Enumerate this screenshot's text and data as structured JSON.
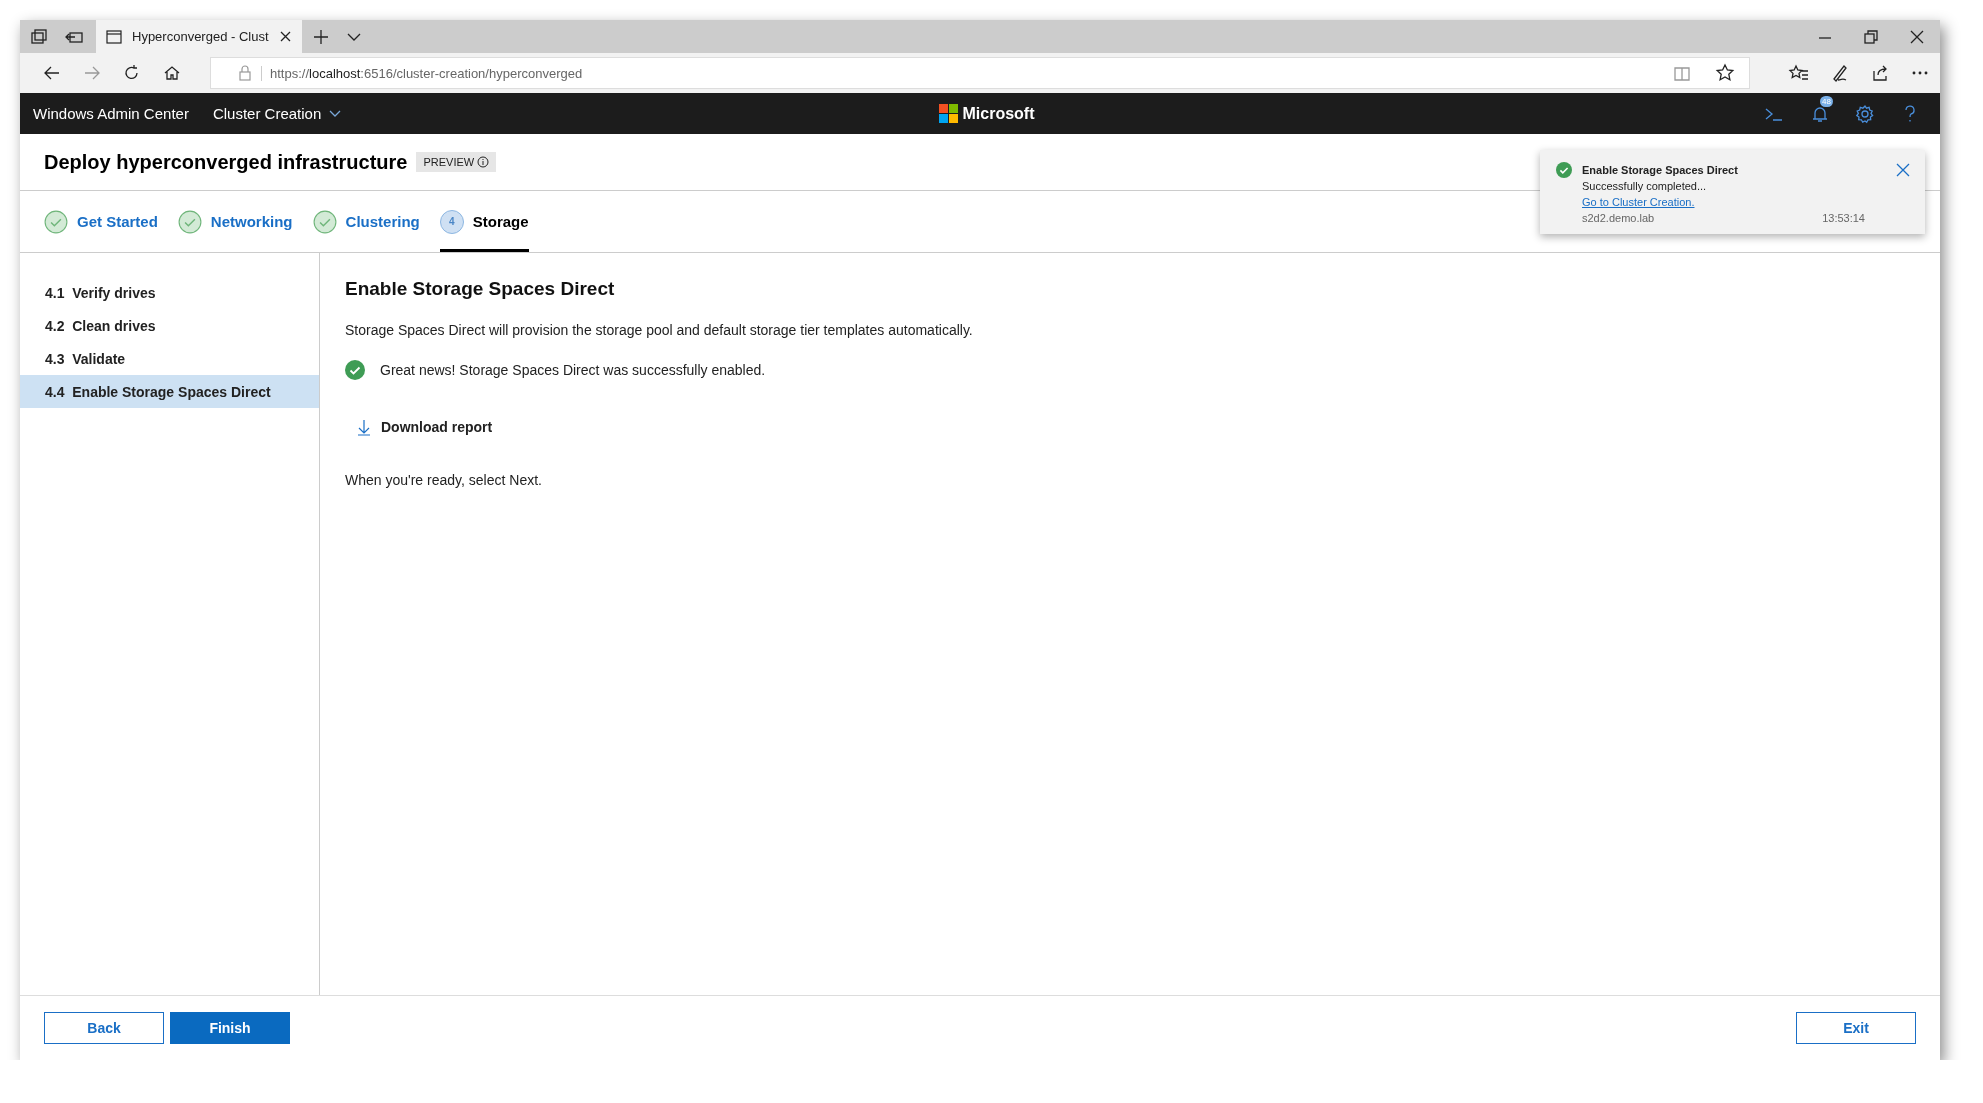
{
  "browser": {
    "tab_title": "Hyperconverged - Clust",
    "url_scheme": "https://",
    "url_host": "localhost",
    "url_rest": ":6516/cluster-creation/hyperconverged"
  },
  "app_bar": {
    "app_name": "Windows Admin Center",
    "context": "Cluster Creation",
    "brand": "Microsoft",
    "notification_count": "48"
  },
  "page": {
    "title": "Deploy hyperconverged infrastructure",
    "badge": "PREVIEW"
  },
  "steps": [
    {
      "label": "Get Started",
      "kind": "done",
      "selected": false
    },
    {
      "label": "Networking",
      "kind": "done",
      "selected": false
    },
    {
      "label": "Clustering",
      "kind": "done",
      "selected": false
    },
    {
      "number": "4",
      "label": "Storage",
      "kind": "current",
      "selected": true
    }
  ],
  "substeps": [
    {
      "number": "4.1",
      "label": "Verify drives",
      "selected": false
    },
    {
      "number": "4.2",
      "label": "Clean drives",
      "selected": false
    },
    {
      "number": "4.3",
      "label": "Validate",
      "selected": false
    },
    {
      "number": "4.4",
      "label": "Enable Storage Spaces Direct",
      "selected": true
    }
  ],
  "content": {
    "heading": "Enable Storage Spaces Direct",
    "description": "Storage Spaces Direct will provision the storage pool and default storage tier templates automatically.",
    "success_message": "Great news! Storage Spaces Direct was successfully enabled.",
    "download_label": "Download report",
    "hint": "When you're ready, select Next."
  },
  "notification": {
    "title": "Enable Storage Spaces Direct",
    "message": "Successfully completed...",
    "link": "Go to Cluster Creation.",
    "source": "s2d2.demo.lab",
    "time": "13:53:14"
  },
  "footer": {
    "left_buttons": [
      {
        "label": "Back",
        "kind": "secondary"
      },
      {
        "label": "Finish",
        "kind": "primary"
      }
    ],
    "right_buttons": [
      {
        "label": "Exit"
      }
    ]
  }
}
